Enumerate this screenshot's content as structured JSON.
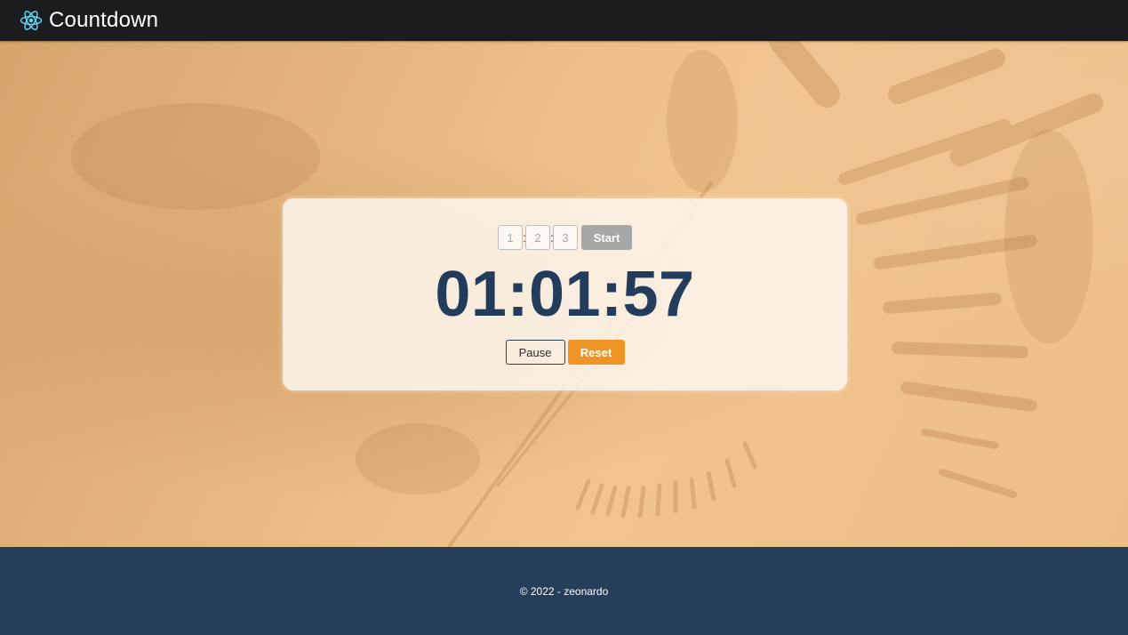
{
  "header": {
    "logo_icon": "react-atom-icon",
    "title": "Countdown",
    "logo_color": "#61dafb"
  },
  "timer_form": {
    "hours_placeholder": "1",
    "minutes_placeholder": "2",
    "seconds_placeholder": "3",
    "separator": ":",
    "start_label": "Start"
  },
  "display": {
    "time": "01:01:57"
  },
  "controls": {
    "pause_label": "Pause",
    "reset_label": "Reset"
  },
  "footer": {
    "copyright": "© 2022 - zeonardo"
  },
  "colors": {
    "navbar": "#1b1c1e",
    "timer_text": "#233c5c",
    "reset_accent": "#ef9526",
    "start_disabled": "#a7a7a7",
    "footer": "#253e5a"
  }
}
